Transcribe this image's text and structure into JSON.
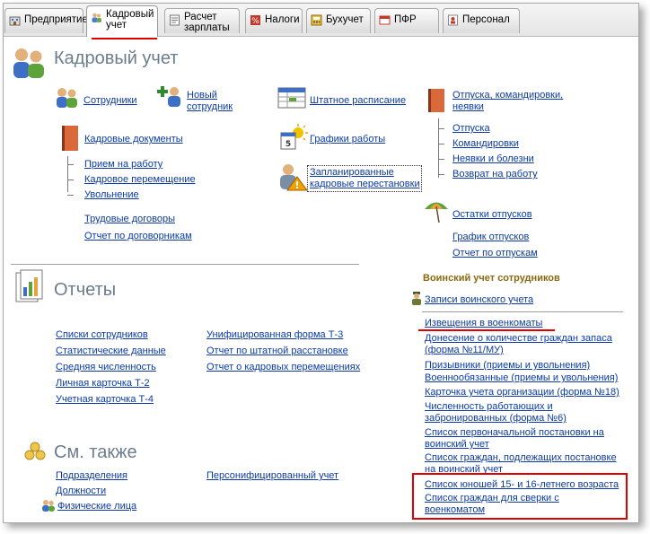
{
  "tabs": [
    {
      "id": "enterprise",
      "label": "Предприятие",
      "icon": "building-icon"
    },
    {
      "id": "hr",
      "label": "Кадровый\nучет",
      "icon": "people-icon",
      "active": true
    },
    {
      "id": "salary",
      "label": "Расчет\nзарплаты",
      "icon": "payroll-icon"
    },
    {
      "id": "taxes",
      "label": "Налоги",
      "icon": "taxes-icon"
    },
    {
      "id": "accounting",
      "label": "Бухучет",
      "icon": "accounting-icon"
    },
    {
      "id": "pfr",
      "label": "ПФР",
      "icon": "pfr-icon"
    },
    {
      "id": "personnel",
      "label": "Персонал",
      "icon": "personnel-icon"
    }
  ],
  "hr": {
    "title": "Кадровый учет",
    "employees": "Сотрудники",
    "new_employee": "Новый сотрудник",
    "staff_schedule": "Штатное расписание",
    "leaves": "Отпуска, командировки, неявки",
    "hr_documents": "Кадровые документы",
    "work_schedules": "Графики работы",
    "hiring": "Прием на работу",
    "transfer": "Кадровое перемещение",
    "dismissal": "Увольнение",
    "planned_transfers": "Запланированные кадровые перестановки",
    "labor_contracts": "Трудовые договоры",
    "contractors_report": "Отчет по договорникам",
    "leave_items": [
      "Отпуска",
      "Командировки",
      "Неявки и болезни",
      "Возврат на работу"
    ],
    "leave_balances": "Остатки отпусков",
    "leave_schedule": "График отпусков",
    "leave_report": "Отчет по отпускам"
  },
  "reports": {
    "title": "Отчеты",
    "col1": [
      "Списки сотрудников",
      "Статистические данные",
      "Средняя численность",
      "Личная карточка Т-2",
      "Учетная карточка Т-4"
    ],
    "col2": [
      "Унифицированная форма Т-3",
      "Отчет по штатной расстановке",
      "Отчет о кадровых перемещениях"
    ]
  },
  "see_also": {
    "title": "См. также",
    "col1": [
      "Подразделения",
      "Должности",
      "Физические лица"
    ],
    "col2": [
      "Персонифицированный учет"
    ]
  },
  "military": {
    "title": "Воинский учет сотрудников",
    "records": "Записи воинского учета",
    "items": [
      "Извещения в военкоматы",
      "Донесение о количестве граждан запаса (форма №11/МУ)",
      "Призывники (приемы и увольнения)",
      "Военнообязанные (приемы и увольнения)",
      "Карточка учета организации (форма №18)",
      "Численность работающих и забронированных (форма №6)",
      "Список первоначальной постановки на воинский учет",
      "Список граждан, подлежащих постановке на воинский учет",
      "Список юношей 15- и 16-летнего возраста",
      "Список граждан для сверки с военкоматом"
    ]
  },
  "colors": {
    "accent_red": "#e00000",
    "link": "#0b3aa6",
    "section_title": "#6b7d8c",
    "military_title": "#8a6a10"
  }
}
